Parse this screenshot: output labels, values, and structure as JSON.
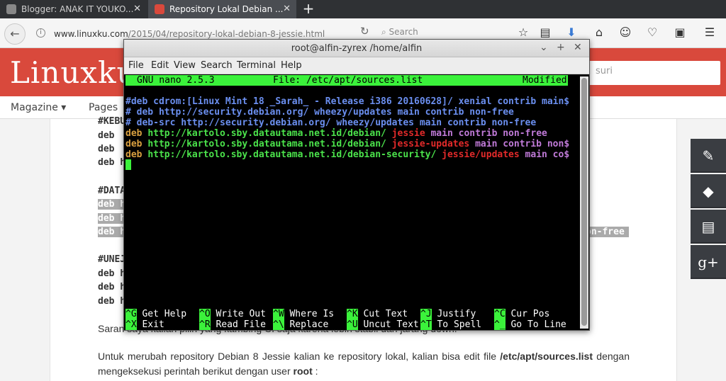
{
  "browser": {
    "tabs": [
      {
        "title": "Blogger: ANAK IT YOUKO...",
        "active": false,
        "favicon_color": "#888888"
      },
      {
        "title": "Repository Lokal Debian ...",
        "active": true,
        "favicon_color": "#d9493c"
      }
    ],
    "new_tab_label": "+",
    "close_label": "✕",
    "url_domain": "www.linuxku.com",
    "url_path": "/2015/04/repository-lokal-debian-8-jessie.html",
    "search_placeholder": "Search",
    "back_icon": "←"
  },
  "site": {
    "logo": "Linuxku.c",
    "search_placeholder": "suri",
    "menu": [
      "Magazine ▾",
      "Pages"
    ],
    "accent": "#d9493c"
  },
  "article": {
    "code_lines": [
      {
        "text": "#KEBU",
        "hl": false
      },
      {
        "text": "deb ",
        "hl": false
      },
      {
        "text": "deb ",
        "hl": false
      },
      {
        "text": "deb h",
        "hl": false
      },
      {
        "text": "#DATA",
        "hl": false
      },
      {
        "text": "deb h",
        "hl": true
      },
      {
        "text": "deb h",
        "hl": true
      },
      {
        "text": "deb h",
        "hl": true
      },
      {
        "text": "#UNEJ",
        "hl": false
      },
      {
        "text": "deb h",
        "hl": false
      },
      {
        "text": "deb h",
        "hl": false
      },
      {
        "text": "deb h",
        "hl": false
      }
    ],
    "hl_tail": "on-free",
    "para1": "Saran saya kalian pilih yang kambing CI saja karena lebih stabil dan jarang down.",
    "para2_a": "Untuk merubah repository Debian 8 Jessie kalian ke repository lokal, kalian bisa edit file ",
    "para2_file": "/etc/apt/sources.list",
    "para2_b": " dengan mengeksekusi perintah berikut dengan user ",
    "para2_user": "root",
    "para2_c": " :"
  },
  "sidebar_icons": [
    "notes-star-icon",
    "tag-icon",
    "archive-icon",
    "google-plus-icon"
  ],
  "terminal": {
    "title": "root@alfin-zyrex /home/alfin",
    "controls": [
      "⌄",
      "+",
      "✕"
    ],
    "menu": [
      "File",
      "Edit",
      "View",
      "Search",
      "Terminal",
      "Help"
    ],
    "nano_version": "GNU nano 2.5.3",
    "file": "File: /etc/apt/sources.list",
    "status": "Modified",
    "lines": [
      [
        {
          "t": "#deb cdrom:[Linux Mint 18 _Sarah_ - Release i386 20160628]/ xenial contrib main$",
          "c": "b"
        }
      ],
      [
        {
          "t": "# deb http://security.debian.org/ wheezy/updates main contrib non-free",
          "c": "b"
        }
      ],
      [
        {
          "t": "# deb-src http://security.debian.org/ wheezy/updates main contrib non-free",
          "c": "b"
        }
      ],
      [
        {
          "t": "deb ",
          "c": "o"
        },
        {
          "t": "http://kartolo.sby.datautama.net.id/debian/ ",
          "c": "g"
        },
        {
          "t": "jessie ",
          "c": "r"
        },
        {
          "t": "main contrib non-free",
          "c": "v"
        }
      ],
      [
        {
          "t": "deb ",
          "c": "o"
        },
        {
          "t": "http://kartolo.sby.datautama.net.id/debian/ ",
          "c": "g"
        },
        {
          "t": "jessie-updates ",
          "c": "r"
        },
        {
          "t": "main contrib non$",
          "c": "v"
        }
      ],
      [
        {
          "t": "deb ",
          "c": "o"
        },
        {
          "t": "http://kartolo.sby.datautama.net.id/debian-security/ ",
          "c": "g"
        },
        {
          "t": "jessie/updates ",
          "c": "r"
        },
        {
          "t": "main co$",
          "c": "v"
        }
      ]
    ],
    "shortcuts_row1": [
      {
        "k": "^G",
        "l": "Get Help"
      },
      {
        "k": "^O",
        "l": "Write Out"
      },
      {
        "k": "^W",
        "l": "Where Is"
      },
      {
        "k": "^K",
        "l": "Cut Text"
      },
      {
        "k": "^J",
        "l": "Justify"
      },
      {
        "k": "^C",
        "l": "Cur Pos"
      }
    ],
    "shortcuts_row2": [
      {
        "k": "^X",
        "l": "Exit"
      },
      {
        "k": "^R",
        "l": "Read File"
      },
      {
        "k": "^\\",
        "l": "Replace"
      },
      {
        "k": "^U",
        "l": "Uncut Text"
      },
      {
        "k": "^T",
        "l": "To Spell"
      },
      {
        "k": "^_",
        "l": "Go To Line"
      }
    ]
  }
}
